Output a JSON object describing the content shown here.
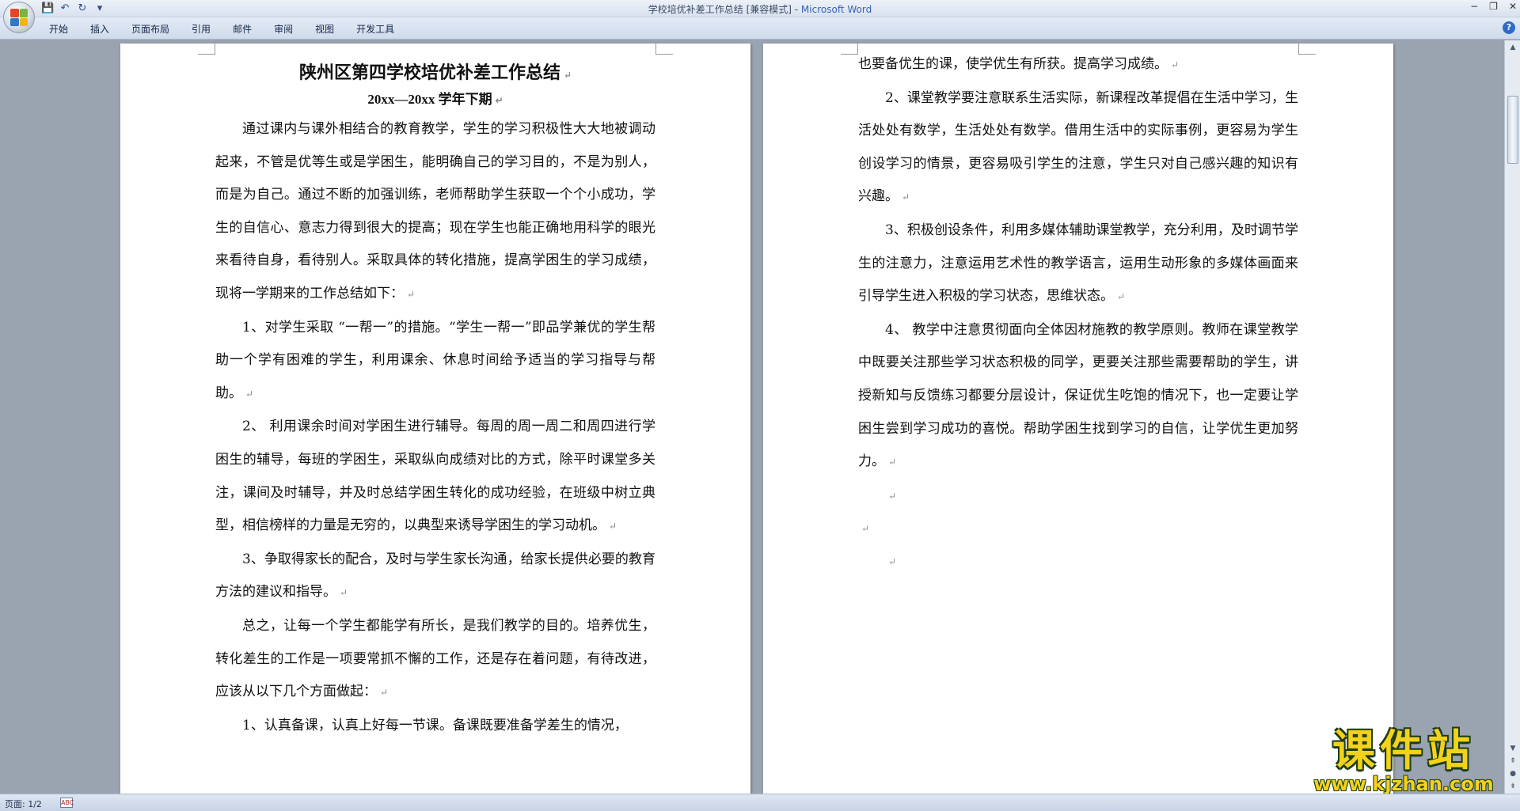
{
  "window": {
    "title": "学校培优补差工作总结 [兼容模式] - ",
    "app_name": "Microsoft Word",
    "controls": {
      "minimize": "−",
      "restore": "❐",
      "close": "✕"
    }
  },
  "quick_access": {
    "save": "💾",
    "undo": "↶",
    "redo": "↻",
    "customize": "▾"
  },
  "ribbon": {
    "tabs": [
      {
        "label": "开始"
      },
      {
        "label": "插入"
      },
      {
        "label": "页面布局"
      },
      {
        "label": "引用"
      },
      {
        "label": "邮件"
      },
      {
        "label": "审阅"
      },
      {
        "label": "视图"
      },
      {
        "label": "开发工具"
      }
    ],
    "help": "?"
  },
  "document": {
    "title": "陕州区第四学校培优补差工作总结",
    "subtitle": "20xx—20xx 学年下期",
    "page1_paragraphs": [
      "通过课内与课外相结合的教育教学，学生的学习积极性大大地被调动起来，不管是优等生或是学困生，能明确自己的学习目的，不是为别人，而是为自己。通过不断的加强训练，老师帮助学生获取一个个小成功，学生的自信心、意志力得到很大的提高；现在学生也能正确地用科学的眼光来看待自身，看待别人。采取具体的转化措施，提高学困生的学习成绩，现将一学期来的工作总结如下：",
      "1、对学生采取 “一帮一”的措施。“学生一帮一”即品学兼优的学生帮助一个学有困难的学生，利用课余、休息时间给予适当的学习指导与帮助。",
      "2、 利用课余时间对学困生进行辅导。每周的周一周二和周四进行学困生的辅导，每班的学困生，采取纵向成绩对比的方式，除平时课堂多关注，课间及时辅导，并及时总结学困生转化的成功经验，在班级中树立典型，相信榜样的力量是无穷的，以典型来诱导学困生的学习动机。",
      "3、争取得家长的配合，及时与学生家长沟通，给家长提供必要的教育方法的建议和指导。",
      "总之，让每一个学生都能学有所长，是我们教学的目的。培养优生，转化差生的工作是一项要常抓不懈的工作，还是存在着问题，有待改进，应该从以下几个方面做起：",
      "1、认真备课，认真上好每一节课。备课既要准备学差生的情况，"
    ],
    "page2_paragraphs": [
      "也要备优生的课，使学优生有所获。提高学习成绩。",
      "2、课堂教学要注意联系生活实际，新课程改革提倡在生活中学习，生活处处有数学，生活处处有数学。借用生活中的实际事例，更容易为学生创设学习的情景，更容易吸引学生的注意，学生只对自己感兴趣的知识有兴趣。",
      "3、积极创设条件，利用多媒体辅助课堂教学，充分利用，及时调节学生的注意力，注意运用艺术性的教学语言，运用生动形象的多媒体画面来引导学生进入积极的学习状态，思维状态。",
      "4、 教学中注意贯彻面向全体因材施教的教学原则。教师在课堂教学中既要关注那些学习状态积极的同学，更要关注那些需要帮助的学生，讲授新知与反馈练习都要分层设计，保证优生吃饱的情况下，也一定要让学困生尝到学习成功的喜悦。帮助学困生找到学习的自信，让学优生更加努力。"
    ],
    "paragraph_mark": "↵"
  },
  "scrollbar": {
    "up": "▲",
    "down": "▼",
    "prev": "⇞",
    "next": "⇟",
    "select": "●"
  },
  "status": {
    "page": "页面: 1/2",
    "icon": "ABC"
  },
  "watermark": {
    "text": "课件站",
    "url": "www.kjzhan.com"
  },
  "colors": {
    "accent": "#3564b8",
    "watermark": "#f3d21b"
  }
}
